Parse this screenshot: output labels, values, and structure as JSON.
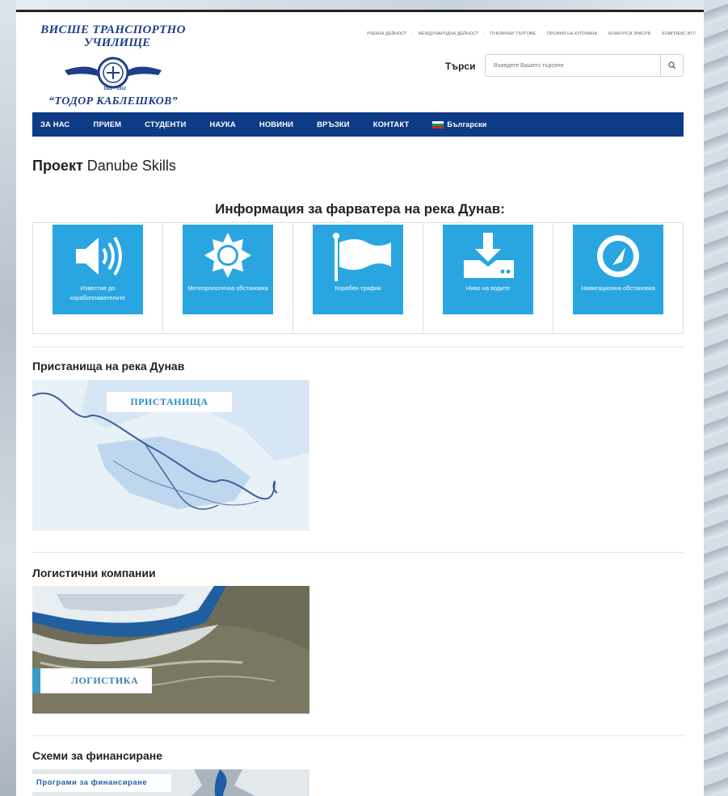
{
  "header": {
    "logo": {
      "line1": "ВИСШЕ ТРАНСПОРТНО",
      "line2": "УЧИЛИЩЕ",
      "line3": "“ТОДОР КАБЛЕШКОВ”",
      "emblem_years": "1922 – 2012"
    },
    "top_links": [
      "УЧЕБНА ДЕЙНОСТ",
      "МЕЖДУНАРОДНА ДЕЙНОСТ",
      "ПУБЛИЧНИ ТЪРГОВЕ",
      "ПРОФИЛ НА КУПУВАЧА",
      "КОНКУРСИ ЗРАСРБ",
      "КОМПЛЕКС ВТУ"
    ],
    "search": {
      "label": "Търси",
      "placeholder": "Въведете Вашето търсене"
    },
    "main_nav": [
      "ЗА НАС",
      "ПРИЕМ",
      "СТУДЕНТИ",
      "НАУКА",
      "НОВИНИ",
      "ВРЪЗКИ",
      "КОНТАКТ"
    ],
    "language": "Български"
  },
  "main": {
    "page_title_bold": "Проект",
    "page_title_rest": "Danube Skills",
    "info_heading": "Информация за фарватера на река Дунав:",
    "tiles": [
      {
        "label": "Известия до корабоплавателите",
        "icon": "speaker-icon"
      },
      {
        "label": "Метеорологична обстановка",
        "icon": "sun-icon"
      },
      {
        "label": "Корабен трафик",
        "icon": "flag-icon"
      },
      {
        "label": "Ниво на водите",
        "icon": "download-icon"
      },
      {
        "label": "Навигационна обстановка",
        "icon": "compass-icon"
      }
    ],
    "sections": [
      {
        "title": "Пристанища на река Дунав",
        "banner": "ПРИСТАНИЩА"
      },
      {
        "title": "Логистични компании",
        "banner": "ЛОГИСТИКА"
      },
      {
        "title": "Схеми за финансиране",
        "banner": "Програми за финансиране"
      }
    ]
  },
  "colors": {
    "nav_bg": "#0d3b86",
    "tile_bg": "#29a6e0",
    "logo_blue": "#1d3f86"
  }
}
